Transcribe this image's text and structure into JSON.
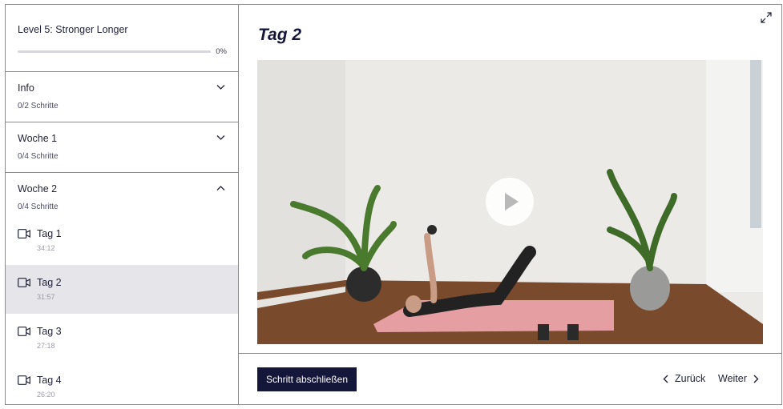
{
  "course": {
    "title": "Level 5: Stronger Longer",
    "progress_percent": 0,
    "progress_label": "0%"
  },
  "sections": [
    {
      "title": "Info",
      "steps": "0/2 Schritte",
      "expanded": false,
      "icon": "chevron-down-icon"
    },
    {
      "title": "Woche 1",
      "steps": "0/4 Schritte",
      "expanded": false,
      "icon": "chevron-down-icon"
    },
    {
      "title": "Woche 2",
      "steps": "0/4 Schritte",
      "expanded": true,
      "icon": "chevron-up-icon"
    }
  ],
  "lessons": [
    {
      "title": "Tag 1",
      "duration": "34:12",
      "icon": "video-camera-icon"
    },
    {
      "title": "Tag 2",
      "duration": "31:57",
      "icon": "video-camera-icon",
      "active": true
    },
    {
      "title": "Tag 3",
      "duration": "27:18",
      "icon": "video-camera-icon"
    },
    {
      "title": "Tag 4",
      "duration": "26:20",
      "icon": "video-camera-icon"
    }
  ],
  "main": {
    "heading": "Tag 2",
    "complete_button": "Schritt abschließen",
    "prev_label": "Zurück",
    "next_label": "Weiter"
  },
  "colors": {
    "accent": "#15173a",
    "active_row": "#e6e6ea",
    "border": "#8a8a8f"
  }
}
